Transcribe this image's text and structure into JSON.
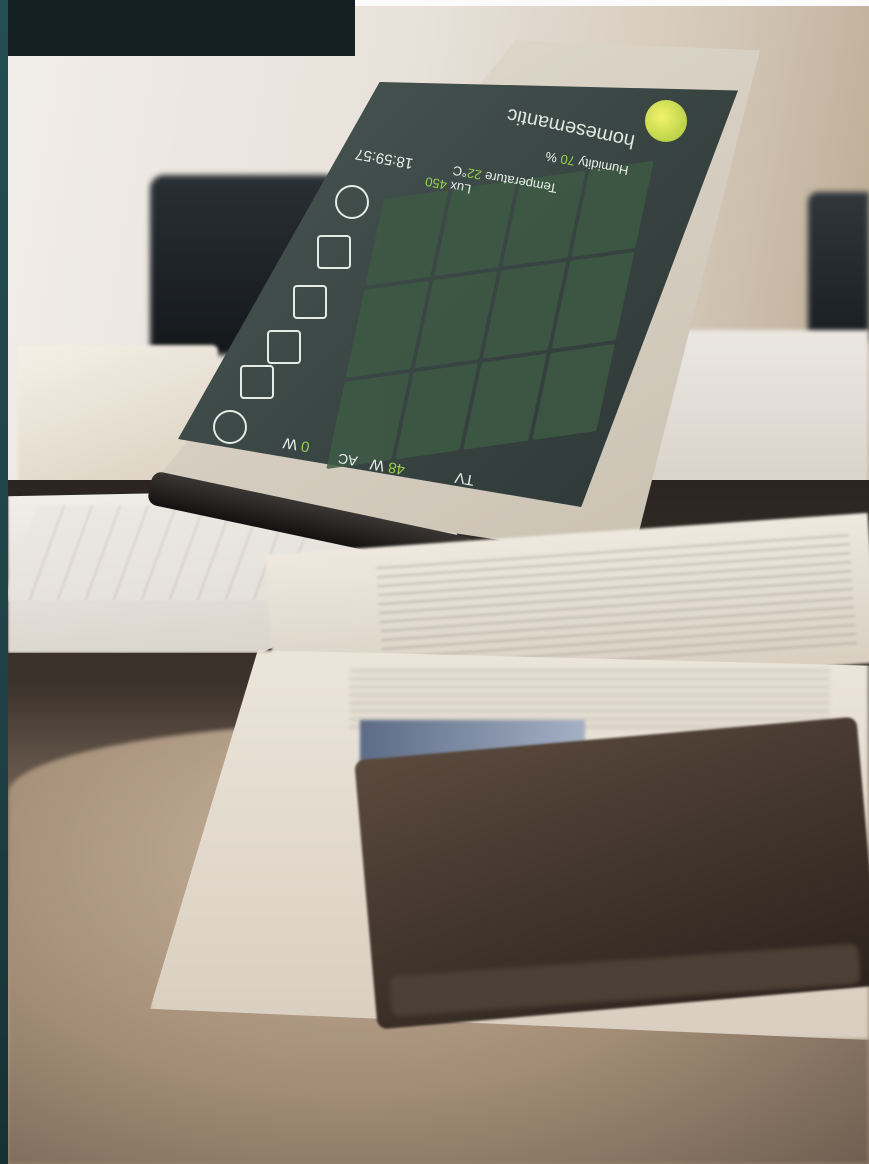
{
  "scene": {
    "description_hidden": "",
    "screen": {
      "brand": "homesemantic",
      "humidity_label": "Humidity",
      "humidity_value": "70",
      "humidity_unit": "%",
      "temperature_label": "Temperature",
      "temperature_value": "22",
      "temperature_unit": "°C",
      "lux_label": "Lux",
      "lux_value": "450",
      "clock": "18:59:57",
      "tv_label": "TV",
      "tv_watts": "48",
      "tv_unit": "W",
      "ac_label": "AC",
      "ac_watts": "0",
      "ac_unit": "W"
    },
    "colors": {
      "screen_bg": "#3a4644",
      "screen_accent": "#95d24a",
      "grid_cell": "#3e5a45"
    }
  }
}
